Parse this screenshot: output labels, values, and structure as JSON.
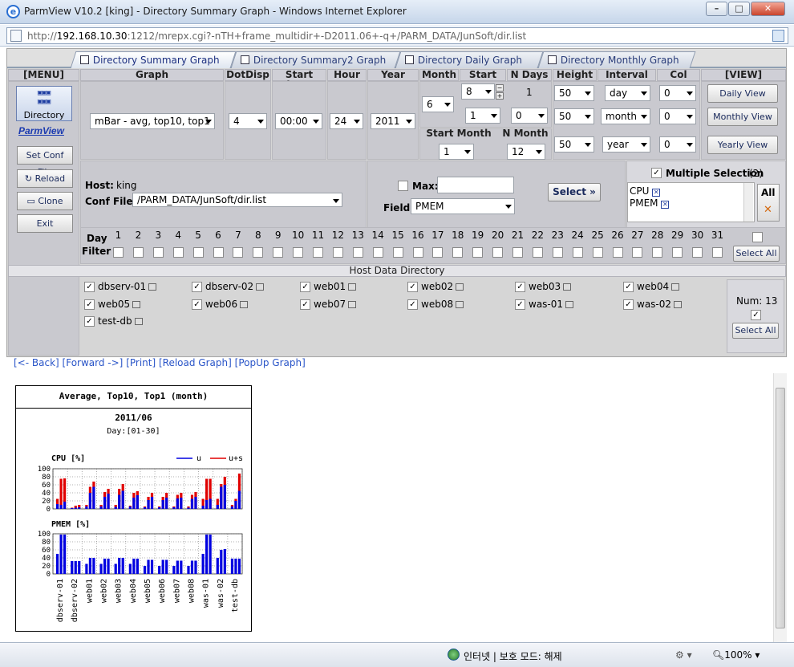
{
  "window": {
    "title": "ParmView V10.2 [king] - Directory Summary Graph - Windows Internet Explorer",
    "url_prefix": "http://",
    "url_host": "192.168.10.30",
    "url_rest": ":1212/mrepx.cgi?-nTH+frame_multidir+-D2011.06+-q+/PARM_DATA/JunSoft/dir.list",
    "min_label": "–",
    "max_label": "□",
    "close_label": "✕"
  },
  "tabs": [
    "Directory Summary Graph",
    "Directory Summary2 Graph",
    "Directory Daily Graph",
    "Directory Monthly Graph"
  ],
  "menu": {
    "header": "[MENU]",
    "directory_label": "Directory",
    "brand": "ParmView",
    "set_conf": "Set Conf File",
    "reload": "Reload",
    "clone": "Clone",
    "exit": "Exit"
  },
  "headers": {
    "graph": "Graph",
    "dotdisp": "DotDisp",
    "start_hour": "Start hour",
    "hour": "Hour",
    "year": "Year",
    "month": "Month",
    "start_day": "Start Day",
    "n_days": "N Days",
    "height": "Height",
    "interval": "Interval",
    "col": "Col",
    "view": "[VIEW]",
    "start_month": "Start Month",
    "n_month": "N Month"
  },
  "controls": {
    "graph": "mBar - avg, top10, top1",
    "dotdisp": "4",
    "start_hour": "00:00",
    "hour": "24",
    "year": "2011",
    "month": "6",
    "start_day": "8",
    "start_day2": "1",
    "n_days": "1",
    "n_days2": "0",
    "height": [
      "50",
      "50",
      "50"
    ],
    "interval": [
      "day",
      "month",
      "year"
    ],
    "col": [
      "0",
      "0",
      "0"
    ],
    "start_month": "1",
    "n_month": "12"
  },
  "view_buttons": [
    "Daily View",
    "Monthly View",
    "Yearly View"
  ],
  "host_panel": {
    "host_label": "Host:",
    "host_value": "king",
    "conf_label": "Conf File:",
    "conf_value": "/PARM_DATA/JunSoft/dir.list",
    "max_label": "Max:",
    "field_label": "Field:",
    "field_value": "PMEM",
    "select_label": "Select",
    "select_arrows": "»"
  },
  "multi": {
    "label": "Multiple Selection",
    "count": "(2)",
    "items": [
      "CPU",
      "PMEM"
    ],
    "all_label": "All"
  },
  "day_filter": {
    "label1": "Day",
    "label2": "Filter",
    "days": [
      "1",
      "2",
      "3",
      "4",
      "5",
      "6",
      "7",
      "8",
      "9",
      "10",
      "11",
      "12",
      "13",
      "14",
      "15",
      "16",
      "17",
      "18",
      "19",
      "20",
      "21",
      "22",
      "23",
      "24",
      "25",
      "26",
      "27",
      "28",
      "29",
      "30",
      "31"
    ],
    "select_all": "Select All"
  },
  "hosts": {
    "header": "Host Data Directory",
    "items": [
      "dbserv-01",
      "dbserv-02",
      "web01",
      "web02",
      "web03",
      "web04",
      "web05",
      "web06",
      "web07",
      "web08",
      "was-01",
      "was-02",
      "test-db"
    ],
    "num_label": "Num: 13",
    "select_all": "Select All"
  },
  "links": [
    "[<- Back]",
    "[Forward ->]",
    "[Print]",
    "[Reload Graph]",
    "[PopUp Graph]"
  ],
  "status": {
    "zone": "인터넷 | 보호 모드: 해제",
    "zoom": "100%"
  },
  "colors": {
    "u": "#0000e0",
    "us": "#e00000",
    "tab_text": "#2a3d7a"
  },
  "chart_data": [
    {
      "type": "bar",
      "title": "Average, Top10, Top1 (month)",
      "subtitle": "2011/06",
      "period": "Day:[01-30]",
      "ylabel": "CPU [%]",
      "ylim": [
        0,
        100
      ],
      "yticks": [
        "100",
        "80",
        "60",
        "40",
        "20",
        "0"
      ],
      "legend": [
        "u",
        "u+s"
      ],
      "categories": [
        "dbserv-01",
        "dbserv-02",
        "web01",
        "web02",
        "web03",
        "web04",
        "web05",
        "web06",
        "web07",
        "web08",
        "was-01",
        "was-02",
        "test-db"
      ],
      "series": [
        {
          "name": "u",
          "values": [
            [
              12,
              10,
              18
            ],
            [
              2,
              3,
              4
            ],
            [
              6,
              40,
              55
            ],
            [
              6,
              30,
              38
            ],
            [
              5,
              35,
              45
            ],
            [
              6,
              28,
              34
            ],
            [
              4,
              22,
              30
            ],
            [
              4,
              22,
              28
            ],
            [
              4,
              26,
              28
            ],
            [
              3,
              25,
              30
            ],
            [
              8,
              22,
              25
            ],
            [
              10,
              55,
              60
            ],
            [
              6,
              20,
              45
            ]
          ]
        },
        {
          "name": "u+s",
          "values": [
            [
              25,
              75,
              76
            ],
            [
              3,
              8,
              10
            ],
            [
              10,
              55,
              68
            ],
            [
              10,
              42,
              50
            ],
            [
              10,
              50,
              62
            ],
            [
              8,
              40,
              44
            ],
            [
              6,
              30,
              40
            ],
            [
              6,
              30,
              40
            ],
            [
              6,
              35,
              40
            ],
            [
              6,
              35,
              42
            ],
            [
              25,
              75,
              75
            ],
            [
              25,
              62,
              80
            ],
            [
              10,
              25,
              88
            ]
          ]
        }
      ]
    },
    {
      "type": "bar",
      "ylabel": "PMEM [%]",
      "ylim": [
        0,
        100
      ],
      "yticks": [
        "100",
        "80",
        "60",
        "40",
        "20",
        "0"
      ],
      "categories": [
        "dbserv-01",
        "dbserv-02",
        "web01",
        "web02",
        "web03",
        "web04",
        "web05",
        "web06",
        "web07",
        "web08",
        "was-01",
        "was-02",
        "test-db"
      ],
      "series": [
        {
          "name": "PMEM",
          "values": [
            [
              50,
              98,
              98
            ],
            [
              32,
              32,
              32
            ],
            [
              25,
              40,
              40
            ],
            [
              25,
              38,
              38
            ],
            [
              25,
              40,
              40
            ],
            [
              25,
              38,
              38
            ],
            [
              20,
              35,
              35
            ],
            [
              20,
              35,
              35
            ],
            [
              20,
              33,
              33
            ],
            [
              20,
              33,
              33
            ],
            [
              50,
              98,
              98
            ],
            [
              40,
              60,
              62
            ],
            [
              38,
              38,
              38
            ]
          ]
        }
      ]
    }
  ]
}
